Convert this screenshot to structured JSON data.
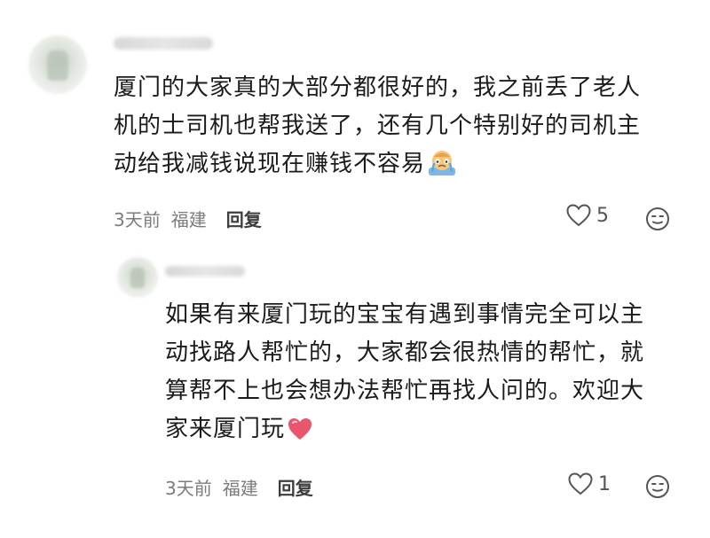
{
  "comments": [
    {
      "text_lines": [
        "厦门的大家真的大部分都很好的，我之前丢了老人",
        "机的士司机也帮我送了，还有几个特别好的司机主",
        "动给我减钱说现在赚钱不容易"
      ],
      "emoji": "crying-face-emoji",
      "time": "3天前",
      "location": "福建",
      "reply_label": "回复",
      "like_count": "5"
    },
    {
      "text_lines": [
        "如果有来厦门玩的宝宝有遇到事情完全可以主",
        "动找路人帮忙的，大家都会很热情的帮忙，就",
        "算帮不上也会想办法帮忙再找人问的。欢迎大",
        "家来厦门玩"
      ],
      "emoji": "heart-emoji",
      "time": "3天前",
      "location": "福建",
      "reply_label": "回复",
      "like_count": "1"
    }
  ],
  "colors": {
    "text": "#1b1b1b",
    "meta": "#7c7c7c",
    "heart": "#e8556d"
  },
  "icons": [
    "heart-outline-icon",
    "emoji-reaction-icon"
  ]
}
